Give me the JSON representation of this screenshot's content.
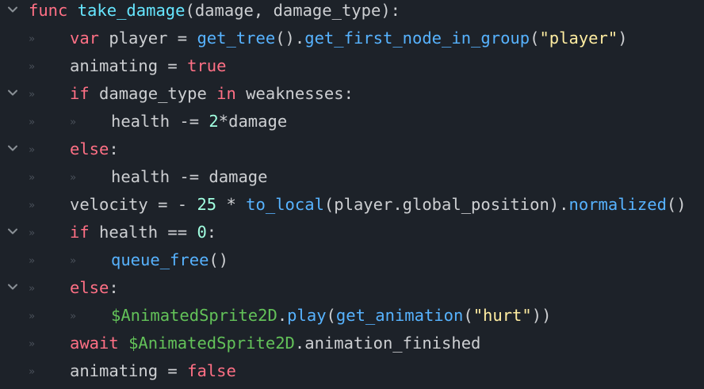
{
  "colors": {
    "background": "#1d2229",
    "text": "#cdcfd2",
    "keyword": "#ff7085",
    "function_call": "#57b3ff",
    "function_name": "#66e6ff",
    "string": "#ffeda1",
    "number": "#a1ffe0",
    "node_path": "#63c259",
    "guide": "#4b525b"
  },
  "icons": {
    "fold": "chevron-down-icon",
    "indent": "tab-indent-icon"
  },
  "guide_glyph": "»",
  "lines": [
    {
      "indent": 0,
      "fold": true,
      "tokens": [
        {
          "t": "func",
          "c": "kw"
        },
        {
          "t": " ",
          "c": "txt"
        },
        {
          "t": "take_damage",
          "c": "def"
        },
        {
          "t": "(damage, damage_type):",
          "c": "txt"
        }
      ]
    },
    {
      "indent": 1,
      "fold": false,
      "tokens": [
        {
          "t": "var",
          "c": "kw"
        },
        {
          "t": " player = ",
          "c": "txt"
        },
        {
          "t": "get_tree",
          "c": "fn"
        },
        {
          "t": "().",
          "c": "txt"
        },
        {
          "t": "get_first_node_in_group",
          "c": "fn"
        },
        {
          "t": "(",
          "c": "txt"
        },
        {
          "t": "\"player\"",
          "c": "str"
        },
        {
          "t": ")",
          "c": "txt"
        }
      ]
    },
    {
      "indent": 1,
      "fold": false,
      "tokens": [
        {
          "t": "animating = ",
          "c": "txt"
        },
        {
          "t": "true",
          "c": "kw"
        }
      ]
    },
    {
      "indent": 1,
      "fold": true,
      "tokens": [
        {
          "t": "if",
          "c": "kw"
        },
        {
          "t": " damage_type ",
          "c": "txt"
        },
        {
          "t": "in",
          "c": "kw"
        },
        {
          "t": " weaknesses:",
          "c": "txt"
        }
      ]
    },
    {
      "indent": 2,
      "fold": false,
      "tokens": [
        {
          "t": "health -= ",
          "c": "txt"
        },
        {
          "t": "2",
          "c": "num"
        },
        {
          "t": "*damage",
          "c": "txt"
        }
      ]
    },
    {
      "indent": 1,
      "fold": true,
      "tokens": [
        {
          "t": "else",
          "c": "kw"
        },
        {
          "t": ":",
          "c": "txt"
        }
      ]
    },
    {
      "indent": 2,
      "fold": false,
      "tokens": [
        {
          "t": "health -= damage",
          "c": "txt"
        }
      ]
    },
    {
      "indent": 1,
      "fold": false,
      "tokens": [
        {
          "t": "velocity = - ",
          "c": "txt"
        },
        {
          "t": "25",
          "c": "num"
        },
        {
          "t": " * ",
          "c": "txt"
        },
        {
          "t": "to_local",
          "c": "fn"
        },
        {
          "t": "(player.global_position).",
          "c": "txt"
        },
        {
          "t": "normalized",
          "c": "fn"
        },
        {
          "t": "()",
          "c": "txt"
        }
      ]
    },
    {
      "indent": 1,
      "fold": true,
      "tokens": [
        {
          "t": "if",
          "c": "kw"
        },
        {
          "t": " health == ",
          "c": "txt"
        },
        {
          "t": "0",
          "c": "num"
        },
        {
          "t": ":",
          "c": "txt"
        }
      ]
    },
    {
      "indent": 2,
      "fold": false,
      "tokens": [
        {
          "t": "queue_free",
          "c": "fn"
        },
        {
          "t": "()",
          "c": "txt"
        }
      ]
    },
    {
      "indent": 1,
      "fold": true,
      "tokens": [
        {
          "t": "else",
          "c": "kw"
        },
        {
          "t": ":",
          "c": "txt"
        }
      ]
    },
    {
      "indent": 2,
      "fold": false,
      "tokens": [
        {
          "t": "$AnimatedSprite2D",
          "c": "node"
        },
        {
          "t": ".",
          "c": "txt"
        },
        {
          "t": "play",
          "c": "fn"
        },
        {
          "t": "(",
          "c": "txt"
        },
        {
          "t": "get_animation",
          "c": "fn"
        },
        {
          "t": "(",
          "c": "txt"
        },
        {
          "t": "\"hurt\"",
          "c": "str"
        },
        {
          "t": "))",
          "c": "txt"
        }
      ]
    },
    {
      "indent": 1,
      "fold": false,
      "tokens": [
        {
          "t": "await",
          "c": "kw"
        },
        {
          "t": " ",
          "c": "txt"
        },
        {
          "t": "$AnimatedSprite2D",
          "c": "node"
        },
        {
          "t": ".animation_finished",
          "c": "txt"
        }
      ]
    },
    {
      "indent": 1,
      "fold": false,
      "tokens": [
        {
          "t": "animating = ",
          "c": "txt"
        },
        {
          "t": "false",
          "c": "kw"
        }
      ]
    }
  ]
}
